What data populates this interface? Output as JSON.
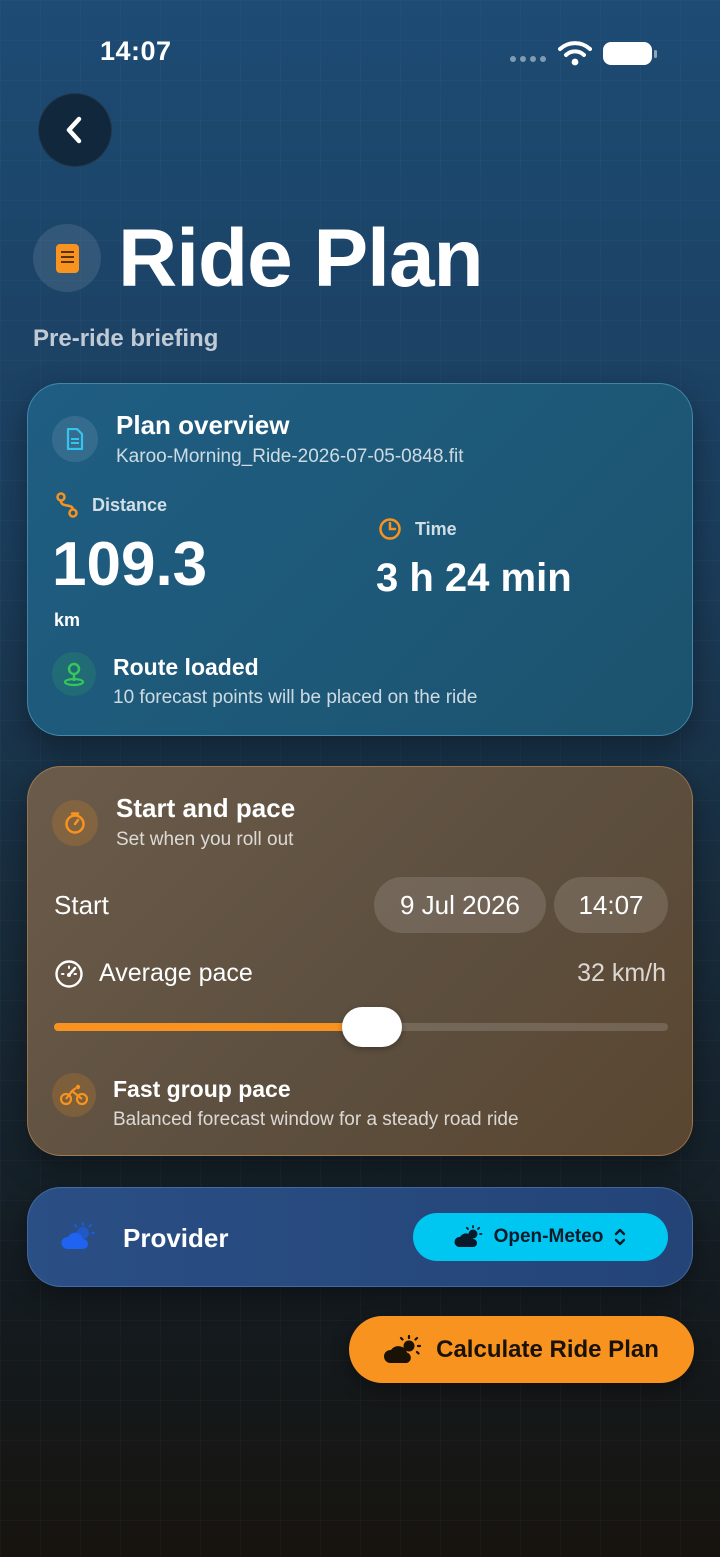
{
  "status": {
    "time": "14:07"
  },
  "header": {
    "title": "Ride Plan",
    "subtitle": "Pre-ride briefing"
  },
  "overview": {
    "title": "Plan overview",
    "filename": "Karoo-Morning_Ride-2026-07-05-0848.fit",
    "distance_label": "Distance",
    "distance_value": "109.3",
    "distance_unit": "km",
    "time_label": "Time",
    "time_value": "3 h 24 min",
    "route_title": "Route loaded",
    "route_sub": "10 forecast points will be placed on the ride"
  },
  "pace": {
    "title": "Start and pace",
    "subtitle": "Set when you roll out",
    "start_label": "Start",
    "start_date": "9 Jul 2026",
    "start_time": "14:07",
    "avg_label": "Average pace",
    "avg_value": "32 km/h",
    "slider_fraction": 0.518,
    "group_title": "Fast group pace",
    "group_sub": "Balanced forecast window for a steady road ride"
  },
  "provider": {
    "label": "Provider",
    "selected": "Open-Meteo"
  },
  "cta": {
    "label": "Calculate Ride Plan"
  },
  "colors": {
    "accent": "#f7931e",
    "provider_select": "#00c6f2",
    "route_green": "#34c759"
  },
  "icons": {
    "back": "chevron-left-icon",
    "title": "list-doc-icon",
    "overview": "document-icon",
    "distance": "route-icon",
    "time": "clock-icon",
    "route": "map-pin-icon",
    "pace": "timer-icon",
    "speed": "speedometer-icon",
    "group": "cyclist-icon",
    "provider": "cloud-sun-icon"
  }
}
